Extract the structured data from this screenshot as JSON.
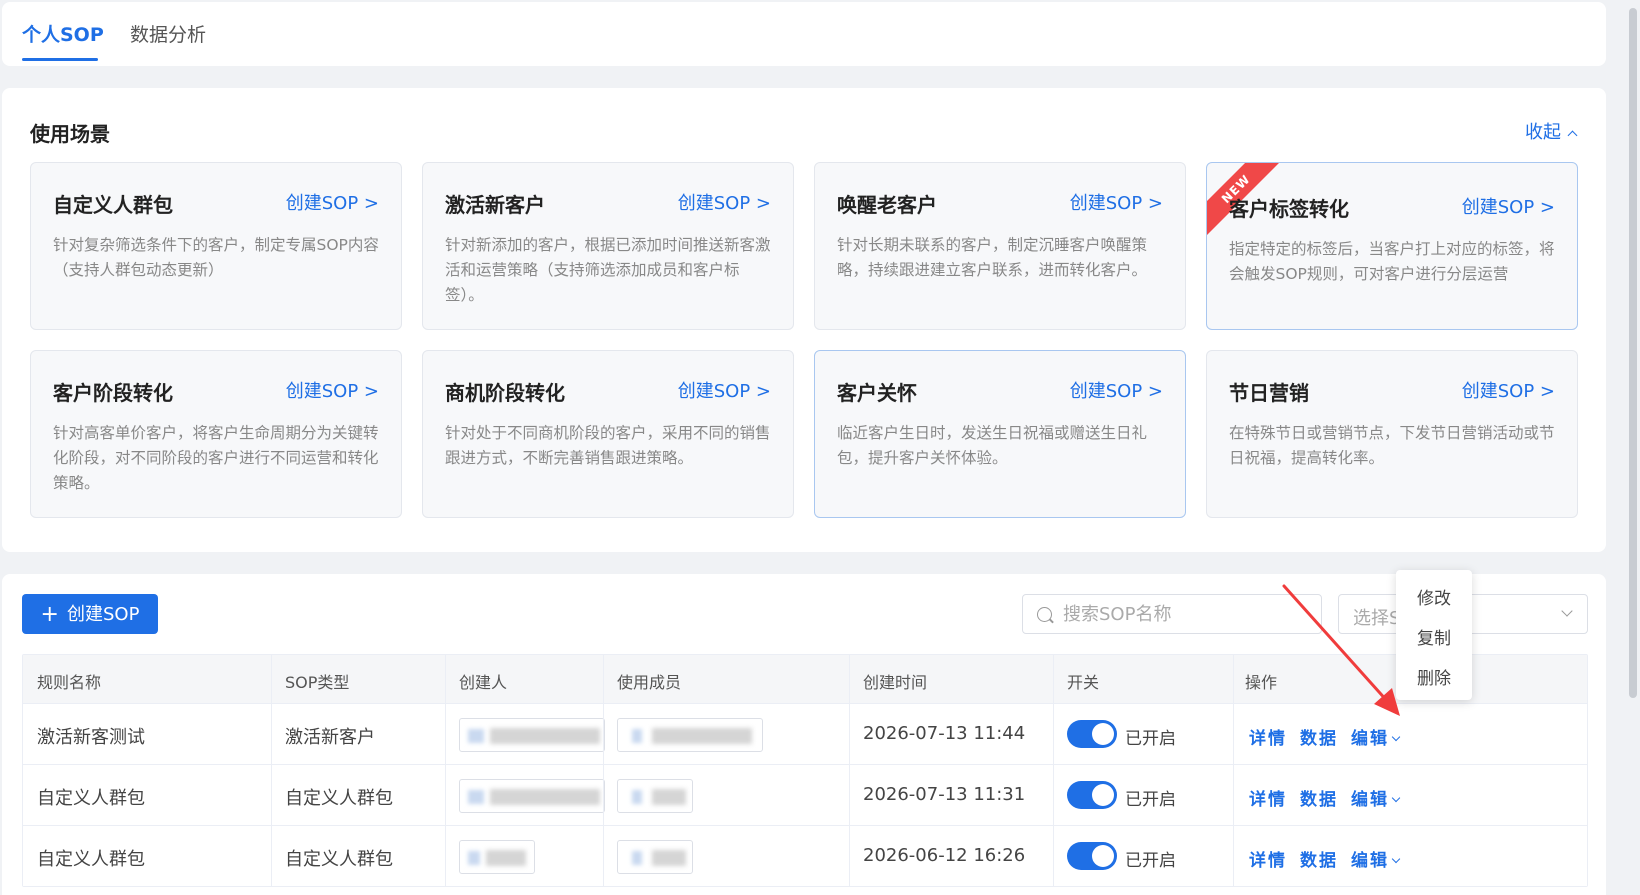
{
  "tabs": [
    {
      "label": "个人SOP",
      "active": true
    },
    {
      "label": "数据分析",
      "active": false
    }
  ],
  "scenes": {
    "title": "使用场景",
    "collapse_label": "收起",
    "new_badge": "NEW",
    "cards": [
      {
        "title": "自定义人群包",
        "create": "创建SOP >",
        "desc": "针对复杂筛选条件下的客户，制定专属SOP内容（支持人群包动态更新）"
      },
      {
        "title": "激活新客户",
        "create": "创建SOP >",
        "desc": "针对新添加的客户，根据已添加时间推送新客激活和运营策略（支持筛选添加成员和客户标签）。"
      },
      {
        "title": "唤醒老客户",
        "create": "创建SOP >",
        "desc": "针对长期未联系的客户，制定沉睡客户唤醒策略，持续跟进建立客户联系，进而转化客户。"
      },
      {
        "title": "客户标签转化",
        "create": "创建SOP >",
        "desc": "指定特定的标签后，当客户打上对应的标签，将会触发SOP规则，可对客户进行分层运营"
      },
      {
        "title": "客户阶段转化",
        "create": "创建SOP >",
        "desc": "针对高客单价客户，将客户生命周期分为关键转化阶段，对不同阶段的客户进行不同运营和转化策略。"
      },
      {
        "title": "商机阶段转化",
        "create": "创建SOP >",
        "desc": "针对处于不同商机阶段的客户，采用不同的销售跟进方式，不断完善销售跟进策略。"
      },
      {
        "title": "客户关怀",
        "create": "创建SOP >",
        "desc": "临近客户生日时，发送生日祝福或赠送生日礼包，提升客户关怀体验。"
      },
      {
        "title": "节日营销",
        "create": "创建SOP >",
        "desc": "在特殊节日或营销节点，下发节日营销活动或节日祝福，提高转化率。"
      }
    ]
  },
  "toolbar": {
    "create_label": "创建SOP",
    "search_placeholder": "搜索SOP名称",
    "select_placeholder": "选择S"
  },
  "table": {
    "headers": [
      "规则名称",
      "SOP类型",
      "创建人",
      "使用成员",
      "创建时间",
      "开关",
      "操作"
    ],
    "rows": [
      {
        "name": "激活新客测试",
        "type": "激活新客户",
        "time": "2026-07-13 11:44",
        "switch": "已开启"
      },
      {
        "name": "自定义人群包",
        "type": "自定义人群包",
        "time": "2026-07-13 11:31",
        "switch": "已开启"
      },
      {
        "name": "自定义人群包",
        "type": "自定义人群包",
        "time": "2026-06-12 16:26",
        "switch": "已开启"
      }
    ],
    "ops": {
      "detail": "详情",
      "data": "数据",
      "edit": "编辑"
    }
  },
  "dropdown": {
    "items": [
      "修改",
      "复制",
      "删除"
    ]
  },
  "colors": {
    "accent": "#1f6fe5",
    "new_badge": "#f04848",
    "arrow": "#f03c3c"
  }
}
